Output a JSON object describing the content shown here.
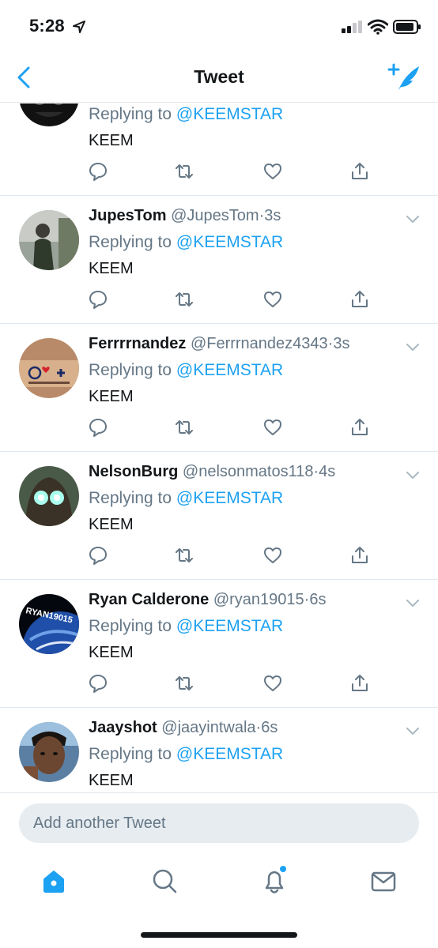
{
  "status_bar": {
    "time": "5:28"
  },
  "nav": {
    "title": "Tweet"
  },
  "tweets": [
    {
      "name": "",
      "handle": "",
      "dot": "",
      "age": "",
      "replying_prefix": "Replying to",
      "replying_to": "@KEEMSTAR",
      "text": "KEEM",
      "avatar": "dark-masked-avatar"
    },
    {
      "name": "JupesTom",
      "handle": "@JupesTom",
      "dot": "·",
      "age": "3s",
      "replying_prefix": "Replying to",
      "replying_to": "@KEEMSTAR",
      "text": "KEEM",
      "avatar": "person-outdoors-avatar"
    },
    {
      "name": "Ferrrrnandez",
      "handle": "@Ferrrnandez4343",
      "dot": "·",
      "age": "3s",
      "replying_prefix": "Replying to",
      "replying_to": "@KEEMSTAR",
      "text": "KEEM",
      "avatar": "peace-love-positivity-avatar"
    },
    {
      "name": "NelsonBurg",
      "handle": "@nelsonmatos118",
      "dot": "·",
      "age": "4s",
      "replying_prefix": "Replying to",
      "replying_to": "@KEEMSTAR",
      "text": "KEEM",
      "avatar": "glowing-eyes-avatar"
    },
    {
      "name": "Ryan Calderone",
      "handle": "@ryan19015",
      "dot": "·",
      "age": "6s",
      "replying_prefix": "Replying to",
      "replying_to": "@KEEMSTAR",
      "text": "KEEM",
      "avatar": "earth-space-avatar",
      "avatar_text": "RYAN19015"
    },
    {
      "name": "Jaayshot",
      "handle": "@jaayintwala",
      "dot": "·",
      "age": "6s",
      "replying_prefix": "Replying to",
      "replying_to": "@KEEMSTAR",
      "text": "KEEM",
      "avatar": "selfie-avatar"
    }
  ],
  "compose": {
    "placeholder": "Add another Tweet"
  },
  "tabs": [
    "home-icon",
    "search-icon",
    "notifications-icon",
    "messages-icon"
  ],
  "colors": {
    "accent": "#1da1f2",
    "secondary_text": "#657786",
    "divider": "#e1e8ed"
  }
}
